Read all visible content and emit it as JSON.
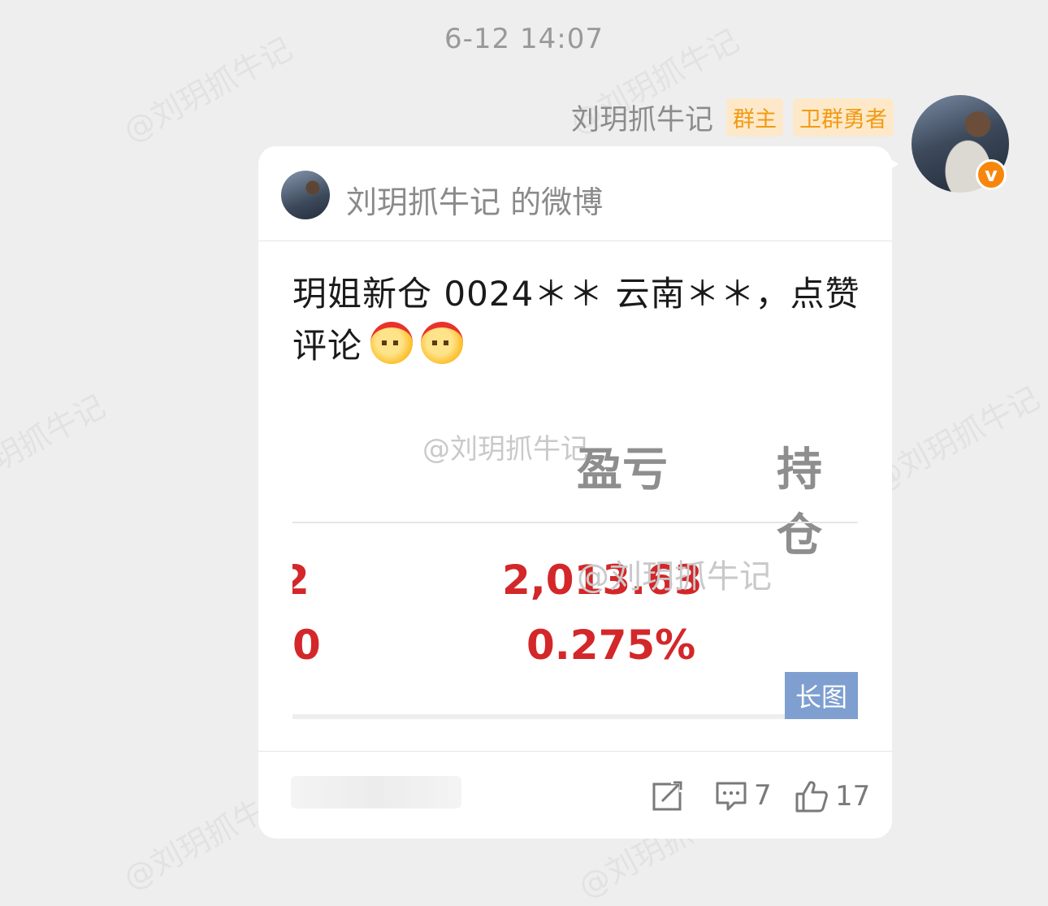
{
  "timestamp": "6-12 14:07",
  "sender": {
    "name": "刘玥抓牛记",
    "badges": [
      "群主",
      "卫群勇者"
    ]
  },
  "card": {
    "title": "刘玥抓牛记 的微博",
    "post_text": "玥姐新仓 0024＊＊ 云南＊＊，点赞评论",
    "image": {
      "col_labels": [
        "盈亏",
        "持仓"
      ],
      "partial_left": [
        "2",
        "0"
      ],
      "values": [
        "2,013.63",
        "0.275%"
      ],
      "watermark": "@刘玥抓牛记",
      "long_image_tag": "长图"
    },
    "footer": {
      "comments": "7",
      "likes": "17"
    }
  },
  "background_watermark": "@刘玥抓牛记",
  "colors": {
    "background": "#eeeeee",
    "badge_text": "#f39a14",
    "badge_bg": "#fde9c9",
    "profit_red": "#d3272a",
    "long_image_tag": "#7e9fcf",
    "verified": "#f7870c"
  }
}
